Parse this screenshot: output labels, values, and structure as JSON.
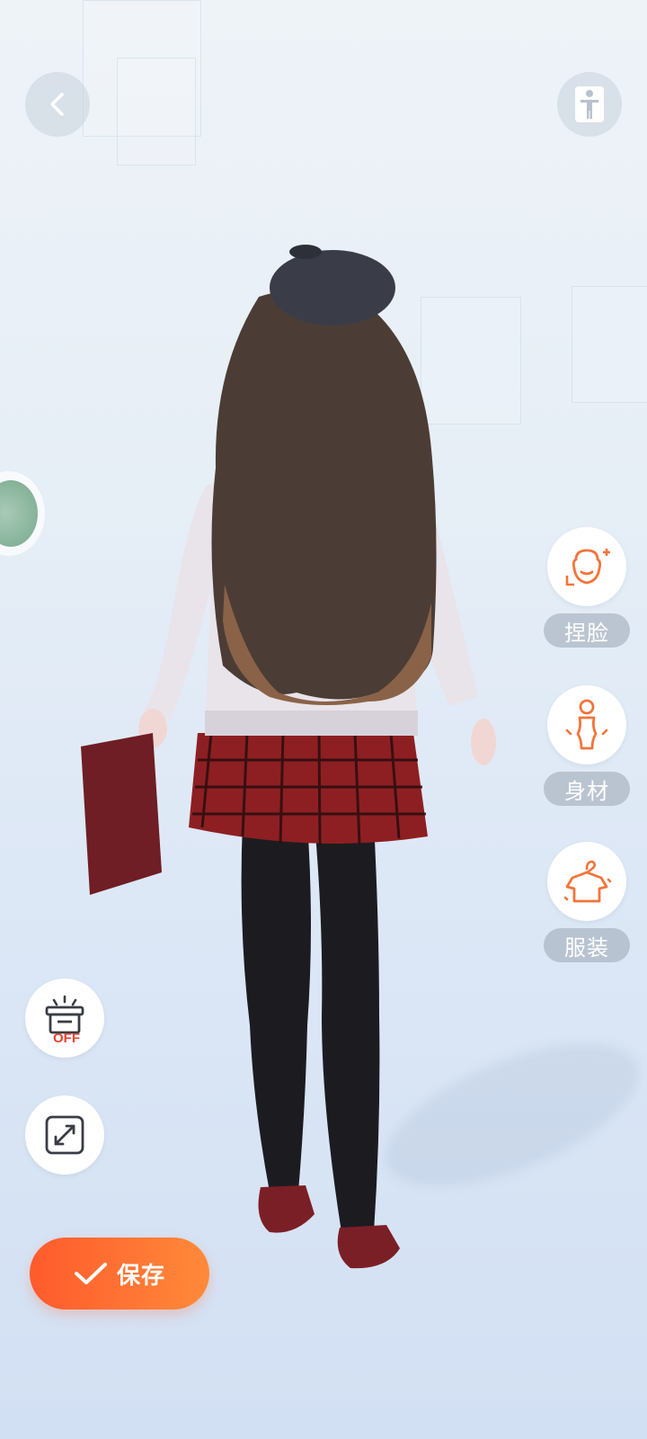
{
  "toolbar": {
    "back_icon": "chevron-left-icon",
    "pose_icon": "person-standing-icon"
  },
  "side_panel": {
    "face_label": "捏脸",
    "body_label": "身材",
    "outfit_label": "服装"
  },
  "left_controls": {
    "scene_toggle_badge": "OFF",
    "scene_toggle_icon": "lamp-off-icon",
    "expand_icon": "expand-icon"
  },
  "save": {
    "label": "保存",
    "icon": "check-icon"
  },
  "colors": {
    "accent_start": "#ff5a2c",
    "accent_end": "#ff8a3a",
    "icon_orange": "#f2743a",
    "badge_red": "#e5412f",
    "label_bg": "#9ba5b2"
  }
}
